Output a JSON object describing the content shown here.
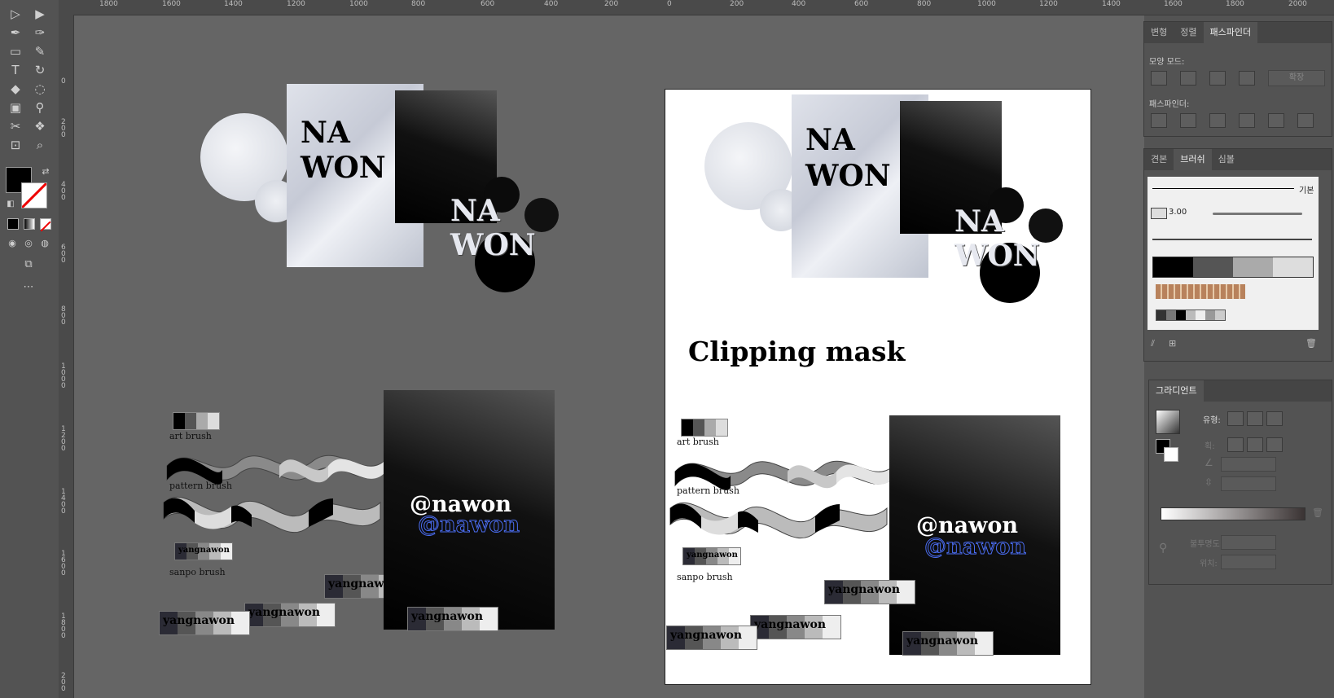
{
  "ruler": {
    "h_ticks": [
      "1800",
      "1600",
      "1400",
      "1200",
      "1000",
      "800",
      "600",
      "400",
      "200",
      "0",
      "200",
      "400",
      "600",
      "800",
      "1000",
      "1200",
      "1400",
      "1600",
      "1800",
      "2000"
    ],
    "v_ticks": [
      "0",
      "2\n0\n0",
      "4\n0\n0",
      "6\n0\n0",
      "8\n0\n0",
      "1\n0\n0\n0",
      "1\n2\n0\n0",
      "1\n4\n0\n0",
      "1\n6\n0\n0",
      "1\n8\n0\n0",
      "2\n0\n0"
    ]
  },
  "canvas": {
    "na": "NA",
    "won": "WON",
    "clipping_title": "Clipping mask",
    "art_brush": "art brush",
    "pattern_brush": "pattern brush",
    "sanpo_brush": "sanpo brush",
    "yangnawon": "yangnawon",
    "handle": "@nawon"
  },
  "pathfinder_panel": {
    "tabs": [
      "변형",
      "정렬",
      "패스파인더"
    ],
    "shape_modes_label": "모양 모드:",
    "expand_label": "확장",
    "pathfinders_label": "패스파인더:"
  },
  "brush_panel": {
    "tabs": [
      "견본",
      "브러쉬",
      "심볼"
    ],
    "basic_label": "기본",
    "size_label": "3.00"
  },
  "gradient_panel": {
    "title": "그라디언트",
    "type_label": "유형:",
    "stroke_label": "획:",
    "opacity_label": "불투명도:",
    "location_label": "위치:"
  },
  "colors": {
    "accent_blue": "#4a6cf0",
    "panel_bg": "#535353",
    "canvas_bg": "#656565"
  }
}
